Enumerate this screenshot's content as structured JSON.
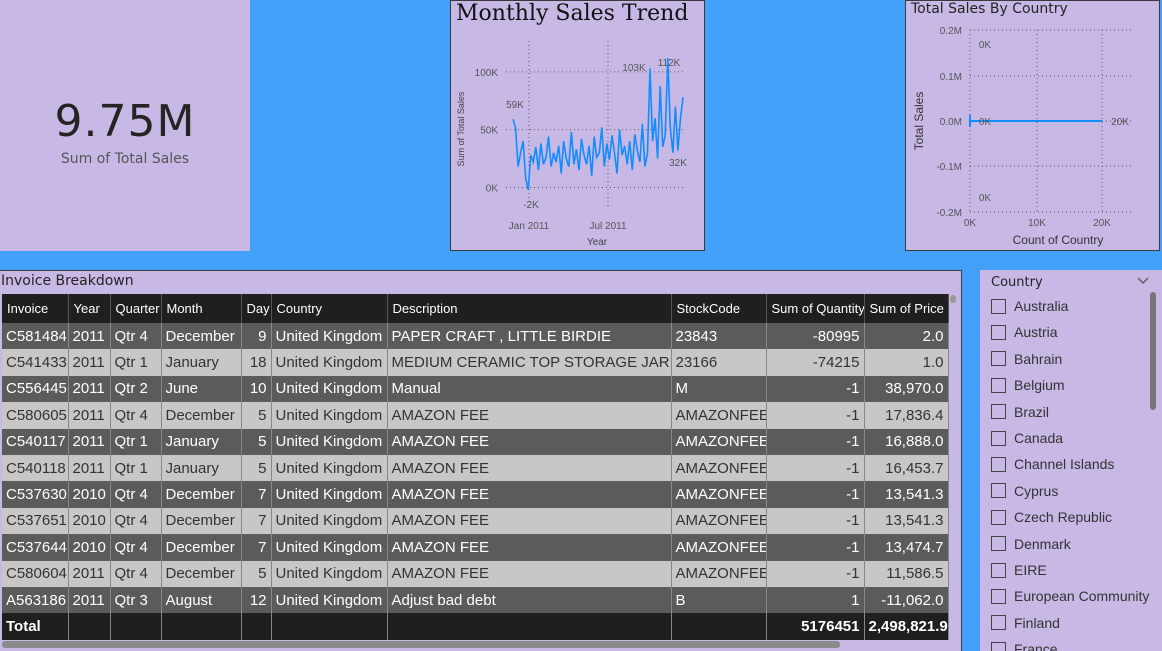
{
  "kpi": {
    "value": "9.75M",
    "caption": "Sum of Total Sales"
  },
  "trend": {
    "title": "Monthly Sales Trend",
    "ylabel": "Sum of Total Sales",
    "xlabel": "Year",
    "yticks": [
      "100K",
      "50K",
      "0K"
    ],
    "xticks": [
      "Jan 2011",
      "Jul 2011"
    ],
    "annotations": [
      "59K",
      "-2K",
      "103K",
      "112K",
      "32K"
    ],
    "color": "#118dff"
  },
  "country_chart": {
    "title": "Total Sales By Country",
    "ylabel": "Total Sales",
    "xlabel": "Count of Country",
    "yticks": [
      "0.2M",
      "0.1M",
      "0.0M",
      "-0.1M",
      "-0.2M"
    ],
    "xticks": [
      "0K",
      "10K",
      "20K"
    ],
    "annotations": [
      "0K",
      "0K",
      "20K",
      "0K"
    ],
    "color": "#118dff"
  },
  "chart_data": [
    {
      "type": "line",
      "title": "Monthly Sales Trend",
      "xlabel": "Year",
      "ylabel": "Sum of Total Sales",
      "x_range": [
        "Dec 2010",
        "Dec 2011"
      ],
      "ylim": [
        -10000,
        125000
      ],
      "series": [
        {
          "values": [
            59000,
            52000,
            18000,
            30000,
            40000,
            8000,
            -2000,
            28000,
            22000,
            35000,
            15000,
            38000,
            20000,
            26000,
            44000,
            18000,
            30000,
            22000,
            36000,
            12000,
            40000,
            25000,
            18000,
            48000,
            20000,
            33000,
            15000,
            42000,
            28000,
            20000,
            36000,
            10000,
            44000,
            26000,
            30000,
            52000,
            18000,
            38000,
            24000,
            45000,
            30000,
            12000,
            50000,
            28000,
            36000,
            20000,
            40000,
            15000,
            46000,
            32000,
            22000,
            55000,
            18000,
            30000,
            103000,
            40000,
            60000,
            25000,
            88000,
            35000,
            45000,
            112000,
            52000,
            30000,
            70000,
            32000,
            60000,
            78000
          ]
        }
      ],
      "labels": [
        {
          "text": "59K",
          "x": "Dec 2010",
          "y": 59000
        },
        {
          "text": "-2K",
          "x": "Jan 2011",
          "y": -2000
        },
        {
          "text": "103K",
          "x": "Nov 2011",
          "y": 103000
        },
        {
          "text": "112K",
          "x": "Nov 2011",
          "y": 112000
        },
        {
          "text": "32K",
          "x": "Dec 2011",
          "y": 32000
        }
      ]
    },
    {
      "type": "line",
      "title": "Total Sales By Country",
      "xlabel": "Count of Country",
      "ylabel": "Total Sales",
      "xlim": [
        0,
        20000
      ],
      "ylim": [
        -200000,
        200000
      ],
      "series": [
        {
          "x": [
            0,
            20000
          ],
          "values": [
            0,
            0
          ]
        }
      ],
      "grid": true
    }
  ],
  "table": {
    "title": "Invoice Breakdown",
    "columns": [
      "Invoice",
      "Year",
      "Quarter",
      "Month",
      "Day",
      "Country",
      "Description",
      "StockCode",
      "Sum of Quantity",
      "Sum of Price"
    ],
    "rows": [
      [
        "C581484",
        "2011",
        "Qtr 4",
        "December",
        "9",
        "United Kingdom",
        "PAPER CRAFT , LITTLE BIRDIE",
        "23843",
        "-80995",
        "2.0"
      ],
      [
        "C541433",
        "2011",
        "Qtr 1",
        "January",
        "18",
        "United Kingdom",
        "MEDIUM CERAMIC TOP STORAGE JAR",
        "23166",
        "-74215",
        "1.0"
      ],
      [
        "C556445",
        "2011",
        "Qtr 2",
        "June",
        "10",
        "United Kingdom",
        "Manual",
        "M",
        "-1",
        "38,970.0"
      ],
      [
        "C580605",
        "2011",
        "Qtr 4",
        "December",
        "5",
        "United Kingdom",
        "AMAZON FEE",
        "AMAZONFEE",
        "-1",
        "17,836.4"
      ],
      [
        "C540117",
        "2011",
        "Qtr 1",
        "January",
        "5",
        "United Kingdom",
        "AMAZON FEE",
        "AMAZONFEE",
        "-1",
        "16,888.0"
      ],
      [
        "C540118",
        "2011",
        "Qtr 1",
        "January",
        "5",
        "United Kingdom",
        "AMAZON FEE",
        "AMAZONFEE",
        "-1",
        "16,453.7"
      ],
      [
        "C537630",
        "2010",
        "Qtr 4",
        "December",
        "7",
        "United Kingdom",
        "AMAZON FEE",
        "AMAZONFEE",
        "-1",
        "13,541.3"
      ],
      [
        "C537651",
        "2010",
        "Qtr 4",
        "December",
        "7",
        "United Kingdom",
        "AMAZON FEE",
        "AMAZONFEE",
        "-1",
        "13,541.3"
      ],
      [
        "C537644",
        "2010",
        "Qtr 4",
        "December",
        "7",
        "United Kingdom",
        "AMAZON FEE",
        "AMAZONFEE",
        "-1",
        "13,474.7"
      ],
      [
        "C580604",
        "2011",
        "Qtr 4",
        "December",
        "5",
        "United Kingdom",
        "AMAZON FEE",
        "AMAZONFEE",
        "-1",
        "11,586.5"
      ],
      [
        "A563186",
        "2011",
        "Qtr 3",
        "August",
        "12",
        "United Kingdom",
        "Adjust bad debt",
        "B",
        "1",
        "-11,062.0"
      ]
    ],
    "total": {
      "label": "Total",
      "quantity": "5176451",
      "price": "2,498,821.9"
    }
  },
  "slicer": {
    "header": "Country",
    "items": [
      "Australia",
      "Austria",
      "Bahrain",
      "Belgium",
      "Brazil",
      "Canada",
      "Channel Islands",
      "Cyprus",
      "Czech Republic",
      "Denmark",
      "EIRE",
      "European Community",
      "Finland",
      "France"
    ]
  }
}
